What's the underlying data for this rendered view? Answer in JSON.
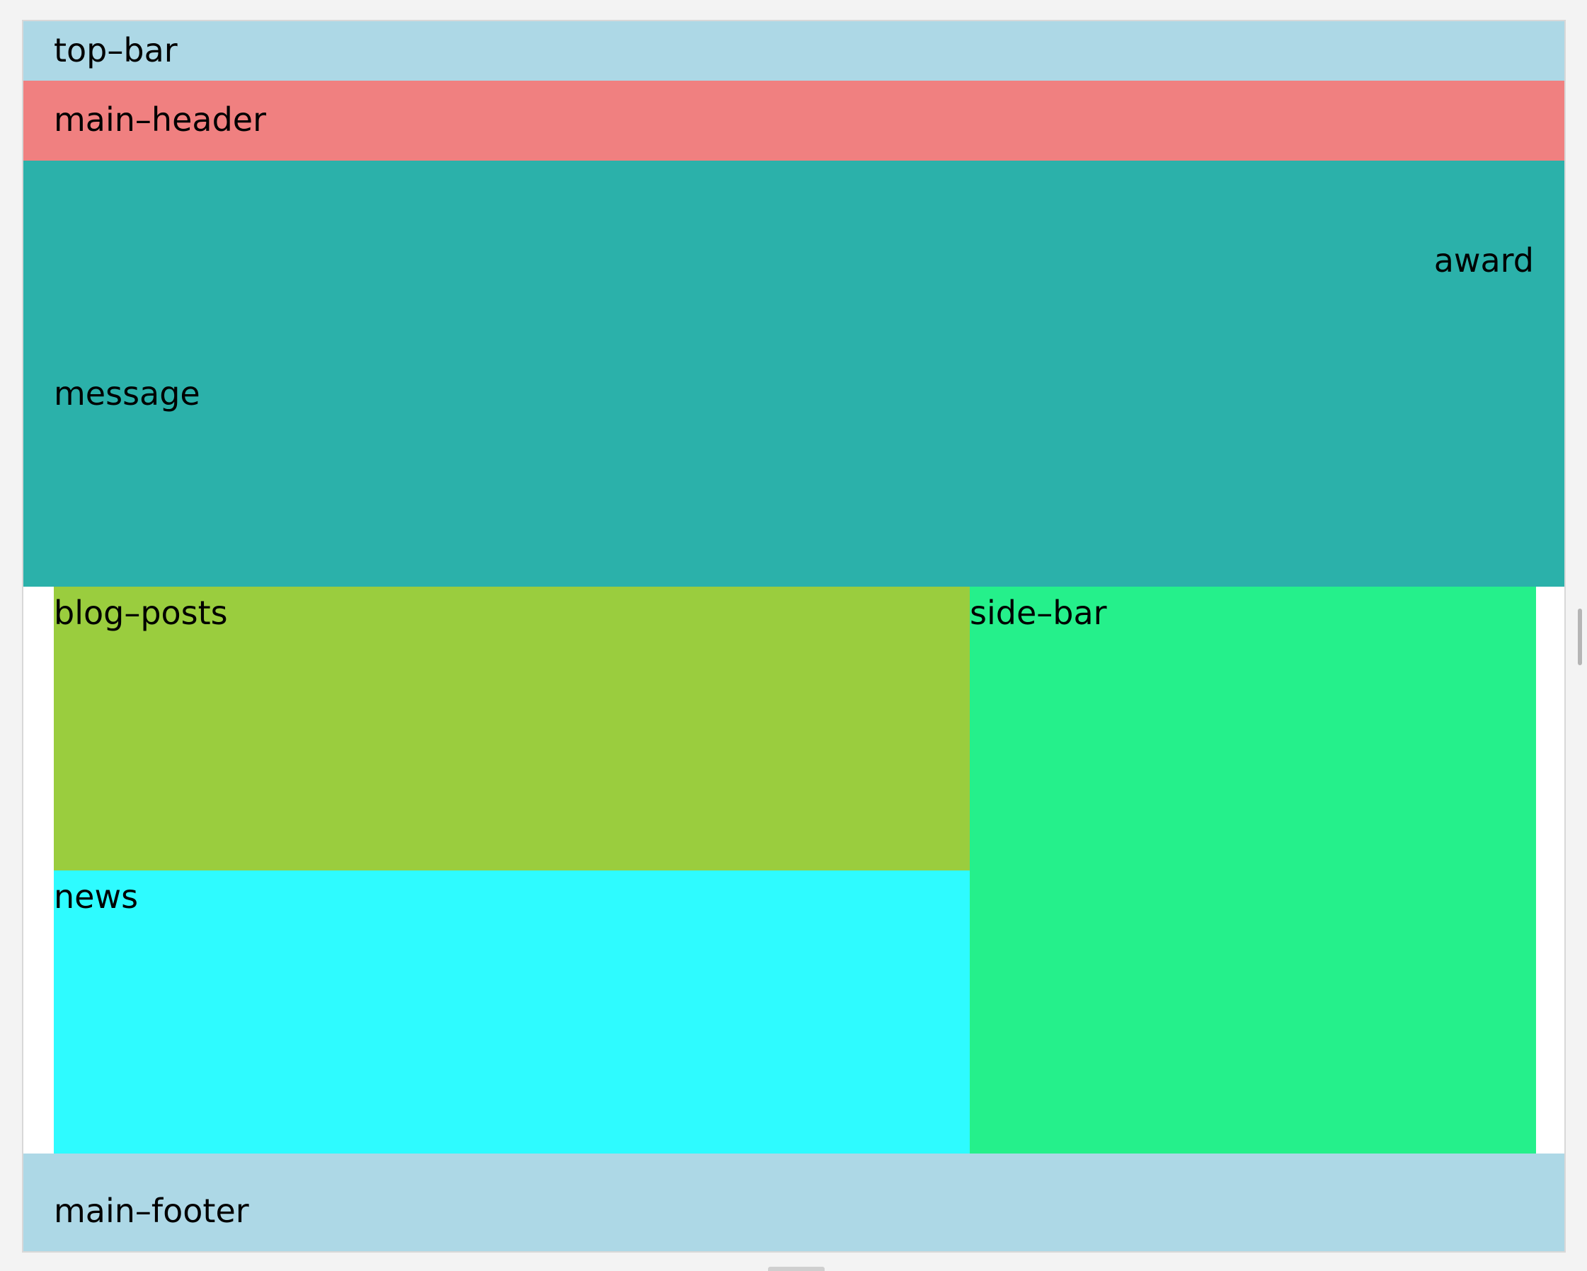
{
  "layout": {
    "top_bar": {
      "label": "top–bar",
      "color": "#add8e6"
    },
    "main_header": {
      "label": "main–header",
      "color": "#f08080"
    },
    "message": {
      "label": "message",
      "color": "#2bb1aa"
    },
    "award": {
      "label": "award"
    },
    "blog_posts": {
      "label": "blog–posts",
      "color": "#9acd3e"
    },
    "news": {
      "label": "news",
      "color": "#2efbff"
    },
    "side_bar": {
      "label": "side–bar",
      "color": "#25f08b"
    },
    "main_footer": {
      "label": "main–footer",
      "color": "#add8e6"
    }
  }
}
